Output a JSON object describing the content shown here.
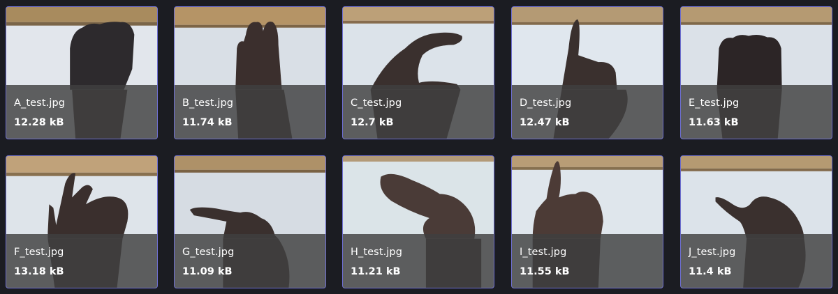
{
  "files": [
    {
      "name": "A_test.jpg",
      "size": "12.28 kB",
      "icon": "hand-a-photo"
    },
    {
      "name": "B_test.jpg",
      "size": "11.74 kB",
      "icon": "hand-b-photo"
    },
    {
      "name": "C_test.jpg",
      "size": "12.7 kB",
      "icon": "hand-c-photo"
    },
    {
      "name": "D_test.jpg",
      "size": "12.47 kB",
      "icon": "hand-d-photo"
    },
    {
      "name": "E_test.jpg",
      "size": "11.63 kB",
      "icon": "hand-e-photo"
    },
    {
      "name": "F_test.jpg",
      "size": "13.18 kB",
      "icon": "hand-f-photo"
    },
    {
      "name": "G_test.jpg",
      "size": "11.09 kB",
      "icon": "hand-g-photo"
    },
    {
      "name": "H_test.jpg",
      "size": "11.21 kB",
      "icon": "hand-h-photo"
    },
    {
      "name": "I_test.jpg",
      "size": "11.55 kB",
      "icon": "hand-i-photo"
    },
    {
      "name": "J_test.jpg",
      "size": "11.4 kB",
      "icon": "hand-j-photo"
    }
  ],
  "colors": {
    "background": "#1b1c22",
    "card_border": "#6e6fd0",
    "caption_bg": "#404040",
    "text": "#ffffff"
  }
}
